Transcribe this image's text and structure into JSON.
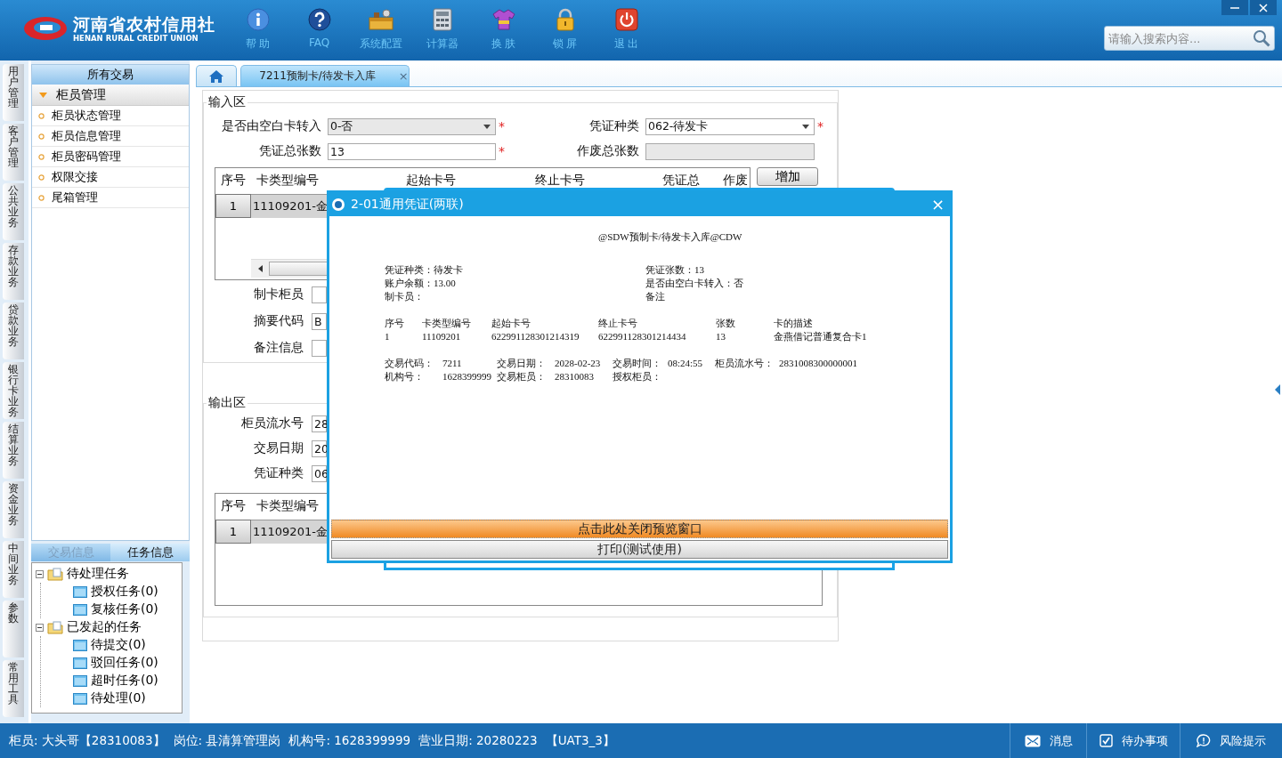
{
  "header": {
    "logo_name": "河南省农村信用社",
    "logo_subtitle": "HENAN RURAL CREDIT UNION"
  },
  "toolbar": [
    {
      "kind": "help",
      "label": "帮 助"
    },
    {
      "kind": "faq",
      "label": "FAQ"
    },
    {
      "kind": "settings",
      "label": "系统配置"
    },
    {
      "kind": "calculator",
      "label": "计算器"
    },
    {
      "kind": "skin",
      "label": "换 肤"
    },
    {
      "kind": "lock",
      "label": "锁 屏"
    },
    {
      "kind": "exit",
      "label": "退 出"
    }
  ],
  "search": {
    "placeholder": "请输入搜索内容..."
  },
  "module_tabs": [
    "用户管理",
    "客户管理",
    "公共业务",
    "存款业务",
    "贷款业务",
    "银行卡业务",
    "结算业务",
    "资金业务",
    "中间业务",
    "参数",
    "常用工具"
  ],
  "sidebar": {
    "title": "所有交易",
    "group": {
      "label": "柜员管理",
      "expanded": true,
      "items": [
        "柜员状态管理",
        "柜员信息管理",
        "柜员密码管理",
        "权限交接",
        "尾箱管理"
      ]
    }
  },
  "task_panel": {
    "tabs": [
      {
        "label": "交易信息",
        "selected": false
      },
      {
        "label": "任务信息",
        "selected": true
      }
    ],
    "tree": [
      {
        "label": "待处理任务",
        "expanded": true,
        "children": [
          {
            "label": "授权任务(0)"
          },
          {
            "label": "复核任务(0)"
          }
        ]
      },
      {
        "label": "已发起的任务",
        "expanded": true,
        "children": [
          {
            "label": "待提交(0)"
          },
          {
            "label": "驳回任务(0)"
          },
          {
            "label": "超时任务(0)"
          },
          {
            "label": "待处理(0)"
          }
        ]
      }
    ]
  },
  "page_tabs": [
    {
      "kind": "home",
      "selected": false
    },
    {
      "kind": "page",
      "label": "7211预制卡/待发卡入库",
      "close": "×",
      "selected": true
    }
  ],
  "input_area": {
    "legend": "输入区",
    "fields": [
      {
        "label": "是否由空白卡转入",
        "kind": "select",
        "value": "0-否",
        "disabled": true,
        "marker": "*"
      },
      {
        "label": "凭证种类",
        "kind": "select",
        "value": "062-待发卡",
        "disabled": false,
        "marker": "*"
      },
      {
        "label": "凭证总张数",
        "kind": "text",
        "value": "13",
        "disabled": false,
        "marker": "*"
      },
      {
        "label": "作废总张数",
        "kind": "text",
        "disabled": true
      }
    ],
    "table": {
      "columns": [
        "序号",
        "卡类型编号",
        "起始卡号",
        "终止卡号",
        "凭证总",
        "作废"
      ],
      "rows": [
        {
          "index": "1",
          "card_type": "11109201-金"
        }
      ]
    },
    "add_button": "增加",
    "extra_fields": [
      {
        "label": "制卡柜员"
      },
      {
        "label": "摘要代码",
        "value": "B"
      },
      {
        "label": "备注信息"
      }
    ]
  },
  "output_area": {
    "legend": "输出区",
    "fields": [
      {
        "label": "柜员流水号",
        "value": "28"
      },
      {
        "label": "交易日期",
        "value": "20"
      },
      {
        "label": "凭证种类",
        "value": "06"
      }
    ],
    "table": {
      "columns": [
        "序号",
        "卡类型编号"
      ],
      "rows": [
        {
          "index": "1",
          "card_type": "11109201-金"
        }
      ]
    }
  },
  "dialog": {
    "title": "2-01通用凭证(两联)",
    "close": "×",
    "voucher": {
      "heading": "@SDW预制卡/待发卡入库@CDW",
      "info_rows": [
        [
          "凭证种类：待发卡",
          "凭证张数：13"
        ],
        [
          "账户余额：13.00",
          "是否由空白卡转入：否"
        ],
        [
          "制卡员：",
          "备注"
        ]
      ],
      "columns": [
        "序号",
        "卡类型编号",
        "起始卡号",
        "终止卡号",
        "张数",
        "卡的描述"
      ],
      "rows": [
        [
          "1",
          "11109201",
          "622991128301214319",
          "622991128301214434",
          "13",
          "金燕借记普通复合卡1"
        ]
      ],
      "footer_rows": [
        [
          "交易代码：",
          "7211",
          "交易日期：",
          "2028-02-23",
          "交易时间：",
          "08:24:55",
          "柜员流水号：",
          "2831008300000001"
        ],
        [
          "机构号：",
          "1628399999",
          "交易柜员：",
          "28310083",
          "授权柜员："
        ]
      ]
    },
    "buttons": [
      {
        "kind": "primary",
        "label": "点击此处关闭预览窗口"
      },
      {
        "kind": "secondary",
        "label": "打印(测试使用)"
      }
    ]
  },
  "status_bar": {
    "segments": [
      "柜员: 大头哥【28310083】",
      "岗位: 县清算管理岗",
      "机构号: 1628399999",
      "营业日期: 20280223",
      "【UAT3_3】"
    ],
    "actions": [
      {
        "kind": "message",
        "label": "消息"
      },
      {
        "kind": "todo",
        "label": "待办事项"
      },
      {
        "kind": "risk",
        "label": "风险提示"
      }
    ]
  }
}
